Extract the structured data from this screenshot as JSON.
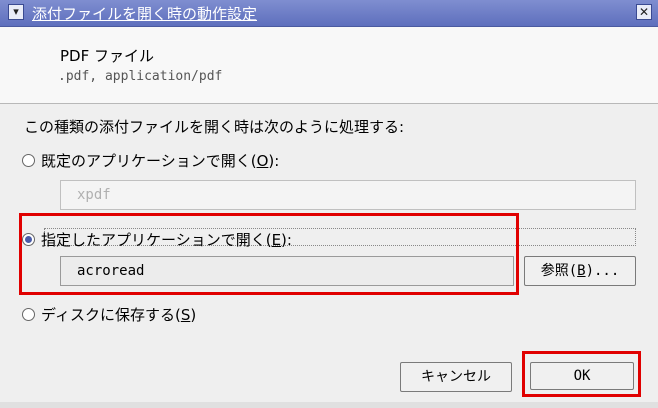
{
  "window": {
    "title": "添付ファイルを開く時の動作設定",
    "menu_glyph": "▾",
    "close_glyph": "✕"
  },
  "file": {
    "type_label": "PDF ファイル",
    "mime_label": ".pdf, application/pdf"
  },
  "prompt": "この種類の添付ファイルを開く時は次のように処理する:",
  "options": {
    "default_app": {
      "label": "既定のアプリケーションで開く(",
      "key": "O",
      "suffix": "):",
      "value": "xpdf"
    },
    "custom_app": {
      "label": "指定したアプリケーションで開く(",
      "key": "E",
      "suffix": "):",
      "value": "acroread"
    },
    "save_disk": {
      "label": "ディスクに保存する(",
      "key": "S",
      "suffix": ")"
    }
  },
  "selected_option": "custom_app",
  "buttons": {
    "browse": {
      "label": "参照(",
      "key": "B",
      "suffix": ")..."
    },
    "cancel": "キャンセル",
    "ok": "OK"
  },
  "colors": {
    "title_bar": "#6a79c4",
    "highlight": "#e00000",
    "radio_selected": "#4a5ca8"
  }
}
